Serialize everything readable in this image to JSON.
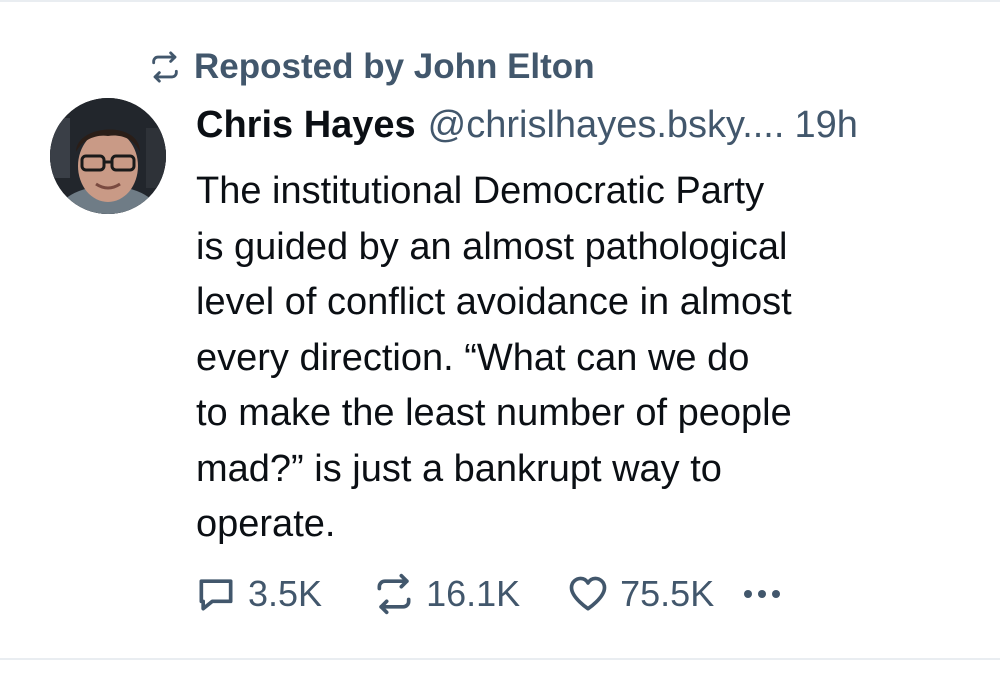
{
  "repost": {
    "label": "Reposted by John Elton",
    "icon": "repost-icon"
  },
  "post": {
    "author_name": "Chris Hayes",
    "handle": "@chrislhayes.bsky....",
    "time": "19h",
    "text": "The institutional Democratic Party\nis guided by an almost pathological\nlevel of conflict avoidance in almost\nevery direction. “What can we do\nto make the least number of people\nmad?” is just a bankrupt way to\noperate."
  },
  "actions": {
    "replies": "3.5K",
    "reposts": "16.1K",
    "likes": "75.5K",
    "reply_icon": "speech-bubble-icon",
    "repost_icon": "repost-icon",
    "like_icon": "heart-icon",
    "more_icon": "ellipsis-icon"
  },
  "colors": {
    "text": "#0b0f14",
    "muted": "#42576c",
    "divider": "#e9edf1"
  }
}
